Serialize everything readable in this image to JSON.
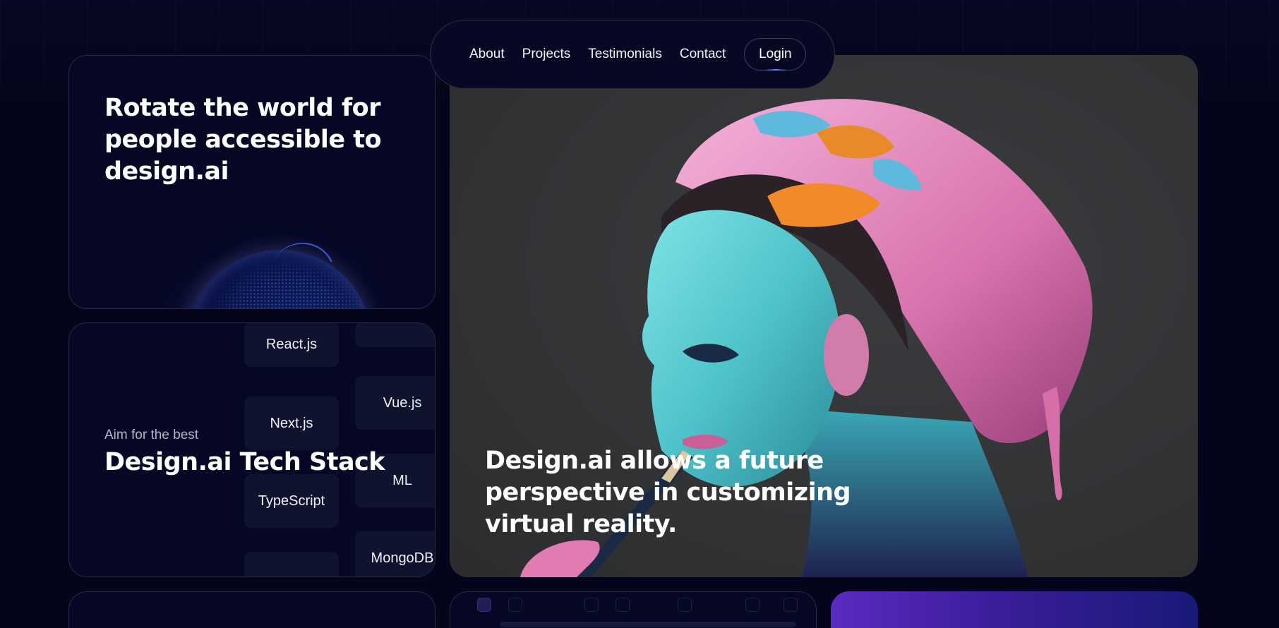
{
  "nav": {
    "links": [
      "About",
      "Projects",
      "Testimonials",
      "Contact"
    ],
    "login_label": "Login"
  },
  "globe_card": {
    "title": "Rotate the world for people accessible to design.ai"
  },
  "tech_card": {
    "subtitle": "Aim for the best",
    "title": "Design.ai Tech Stack",
    "chips_left": [
      "React.js",
      "Next.js",
      "TypeScript",
      ""
    ],
    "chips_right": [
      "",
      "Vue.js",
      "ML",
      "MongoDB"
    ]
  },
  "hero": {
    "caption": "Design.ai allows a future perspective in customizing virtual reality."
  },
  "colors": {
    "background": "#04051a",
    "card": "#050725",
    "chip": "#10132e",
    "hero_bg": "#343537",
    "gradient_card_start": "#5a2bc0",
    "gradient_card_end": "#181a78"
  }
}
